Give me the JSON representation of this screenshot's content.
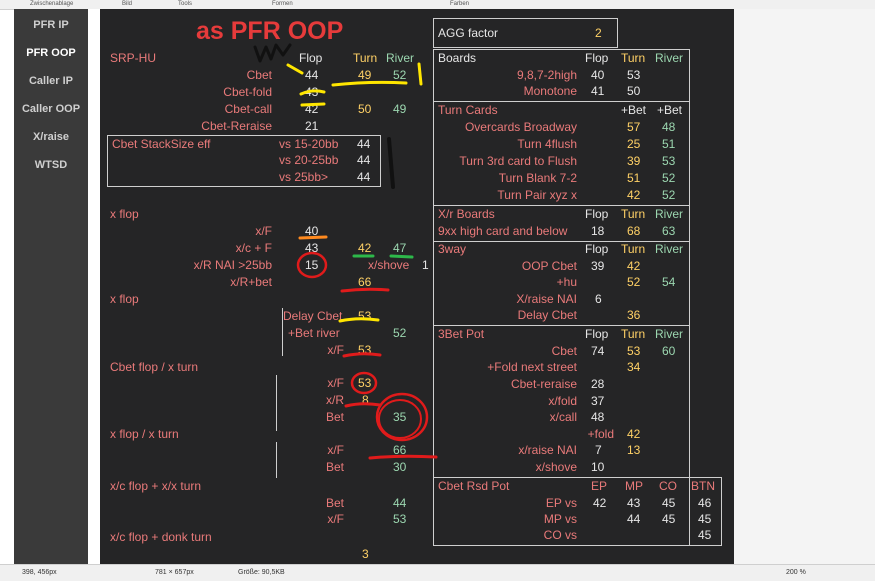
{
  "topbar": {
    "m1": "Zwischenablage",
    "m2": "Bild",
    "m3": "Tools",
    "m4": "Formen",
    "m5": "Farben"
  },
  "sidebar": {
    "items": [
      {
        "label": "PFR IP"
      },
      {
        "label": "PFR OOP"
      },
      {
        "label": "Caller IP"
      },
      {
        "label": "Caller OOP"
      },
      {
        "label": "X/raise"
      },
      {
        "label": "WTSD"
      }
    ]
  },
  "main": {
    "title": "as PFR OOP",
    "srp": "SRP-HU",
    "hdr": {
      "flop": "Flop",
      "turn": "Turn",
      "river": "River"
    },
    "rows": {
      "cbet": {
        "label": "Cbet",
        "flop": "44",
        "turn": "49",
        "river": "52"
      },
      "cbetfold": {
        "label": "Cbet-fold",
        "flop": "43"
      },
      "cbetcall": {
        "label": "Cbet-call",
        "flop": "42",
        "turn": "50",
        "river": "49"
      },
      "cbetreraise": {
        "label": "Cbet-Reraise",
        "flop": "21"
      }
    },
    "stack": {
      "label": "Cbet  StackSize eff",
      "r1": "vs 15-20bb",
      "v1": "44",
      "r2": "vs 20-25bb",
      "v2": "44",
      "r3": "vs 25bb>",
      "v3": "44"
    },
    "xflop1": {
      "title": "x flop",
      "xf": "x/F",
      "xfv": "40",
      "xcf": "x/c + F",
      "xcfv": "43",
      "xcft": "42",
      "xcfr": "47",
      "xr": "x/R NAI >25bb",
      "xrv": "15",
      "xshove": "x/shove",
      "xshovev": "1",
      "xrbet": "x/R+bet",
      "xrbetv": "66"
    },
    "xflop2": {
      "title": "x flop",
      "delay": "Delay Cbet",
      "delayv": "53",
      "betriver": "+Bet river",
      "betriverv": "52",
      "xf": "x/F",
      "xfv": "53"
    },
    "cbetxturn": {
      "title": "Cbet flop / x turn",
      "xf": "x/F",
      "xfv": "53",
      "xr": "x/R",
      "xrv": "8",
      "bet": "Bet",
      "betv": "35"
    },
    "xflopxturn": {
      "title": "x flop / x turn",
      "xf": "x/F",
      "xfv": "66",
      "bet": "Bet",
      "betv": "30"
    },
    "xcxx": {
      "title": "x/c flop + x/x turn",
      "bet": "Bet",
      "betv": "44",
      "xf": "x/F",
      "xfv": "53"
    },
    "xcdonk": {
      "title": "x/c flop + donk turn",
      "v": "3"
    }
  },
  "right": {
    "agg": {
      "label": "AGG factor",
      "value": "2"
    },
    "boards": {
      "title": "Boards",
      "flop": "Flop",
      "turn": "Turn",
      "river": "River",
      "r1": "9,8,7-2high",
      "r1f": "40",
      "r1t": "53",
      "r2": "Monotone",
      "r2f": "41",
      "r2t": "50"
    },
    "turncards": {
      "title": "Turn Cards",
      "bet1": "+Bet",
      "bet2": "+Bet",
      "rows": [
        {
          "l": "Overcards Broadway",
          "a": "57",
          "b": "48"
        },
        {
          "l": "Turn 4flush",
          "a": "25",
          "b": "51"
        },
        {
          "l": "Turn 3rd card to Flush",
          "a": "39",
          "b": "53"
        },
        {
          "l": "Turn Blank 7-2",
          "a": "51",
          "b": "52"
        },
        {
          "l": "Turn Pair xyz x",
          "a": "42",
          "b": "52"
        }
      ]
    },
    "xrboards": {
      "title": "X/r Boards",
      "flop": "Flop",
      "turn": "Turn",
      "river": "River",
      "r1": "9xx high card and below",
      "r1f": "18",
      "r1t": "68",
      "r1r": "63"
    },
    "threeway": {
      "title": "3way",
      "flop": "Flop",
      "turn": "Turn",
      "river": "River",
      "r1": "OOP Cbet",
      "r1f": "39",
      "r1t": "42",
      "r2": "+hu",
      "r2t": "52",
      "r2r": "54",
      "r3": "X/raise NAI",
      "r3f": "6",
      "r4": "Delay Cbet",
      "r4t": "36"
    },
    "threebet": {
      "title": "3Bet Pot",
      "flop": "Flop",
      "turn": "Turn",
      "river": "River",
      "rows": [
        {
          "l": "Cbet",
          "f": "74",
          "t": "53",
          "r": "60"
        },
        {
          "l": "+Fold next street",
          "f": "",
          "t": "34",
          "r": ""
        },
        {
          "l": "Cbet-reraise",
          "f": "28",
          "t": "",
          "r": ""
        },
        {
          "l": "x/fold",
          "f": "37",
          "t": "",
          "r": ""
        },
        {
          "l": "x/call",
          "f": "48",
          "t": "",
          "r": ""
        },
        {
          "l": "+fold",
          "f": "",
          "t": "42",
          "r": ""
        },
        {
          "l": "x/raise NAI",
          "f": "7",
          "t": "13",
          "r": ""
        },
        {
          "l": "x/shove",
          "f": "10",
          "t": "",
          "r": ""
        }
      ]
    },
    "cbetrsd": {
      "title": "Cbet Rsd Pot",
      "ep": "EP",
      "mp": "MP",
      "co": "CO",
      "btn": "BTN",
      "r1": "EP vs",
      "r1a": "42",
      "r1b": "43",
      "r1c": "45",
      "r1d": "46",
      "r2": "MP vs",
      "r2b": "44",
      "r2c": "45",
      "r2d": "45",
      "r3": "CO vs",
      "r3d": "45"
    }
  },
  "status": {
    "pos": "398, 456px",
    "sel": "781 × 657px",
    "size": "Größe: 90,5KB",
    "zoom": "200 %"
  }
}
